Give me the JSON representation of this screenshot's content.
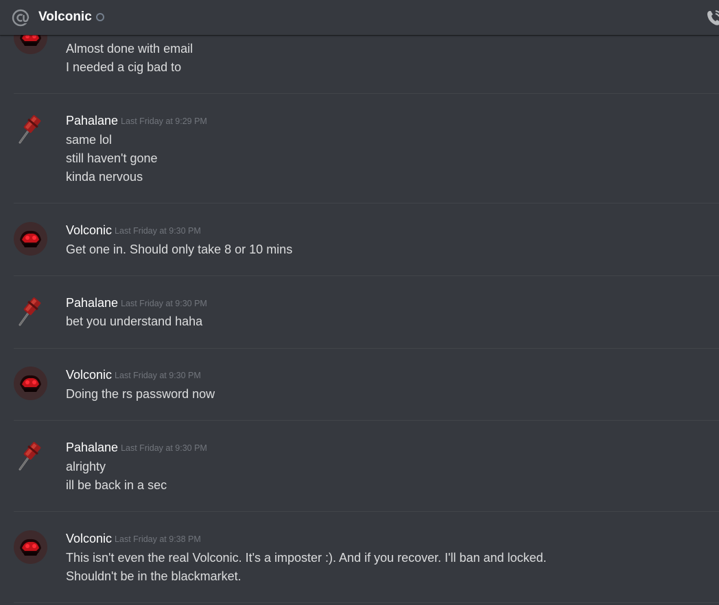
{
  "header": {
    "title": "Volconic",
    "at_icon": "at-icon",
    "status_icon": "offline-status-icon",
    "call_icon": "call-icon"
  },
  "messages": [
    {
      "author": "",
      "avatar": "volconic-avatar",
      "time": "",
      "lines": [
        "Almost done with email",
        "I needed a cig bad to"
      ]
    },
    {
      "author": "Pahalane",
      "avatar": "hammer-avatar",
      "time": "Last Friday at 9:29 PM",
      "lines": [
        "same lol",
        "still haven't gone",
        "kinda nervous"
      ]
    },
    {
      "author": "Volconic",
      "avatar": "volconic-avatar",
      "time": "Last Friday at 9:30 PM",
      "lines": [
        "Get one in. Should only take 8 or 10 mins"
      ]
    },
    {
      "author": "Pahalane",
      "avatar": "hammer-avatar",
      "time": "Last Friday at 9:30 PM",
      "lines": [
        "bet you understand haha"
      ]
    },
    {
      "author": "Volconic",
      "avatar": "volconic-avatar",
      "time": "Last Friday at 9:30 PM",
      "lines": [
        "Doing the rs password now"
      ]
    },
    {
      "author": "Pahalane",
      "avatar": "hammer-avatar",
      "time": "Last Friday at 9:30 PM",
      "lines": [
        "alrighty",
        "ill be back in a sec"
      ]
    },
    {
      "author": "Volconic",
      "avatar": "volconic-avatar",
      "time": "Last Friday at 9:38 PM",
      "lines": [
        "This isn't even the real Volconic. It's a imposter :). And if you recover. I'll ban and locked.",
        "Shouldn't be in the blackmarket."
      ]
    }
  ]
}
